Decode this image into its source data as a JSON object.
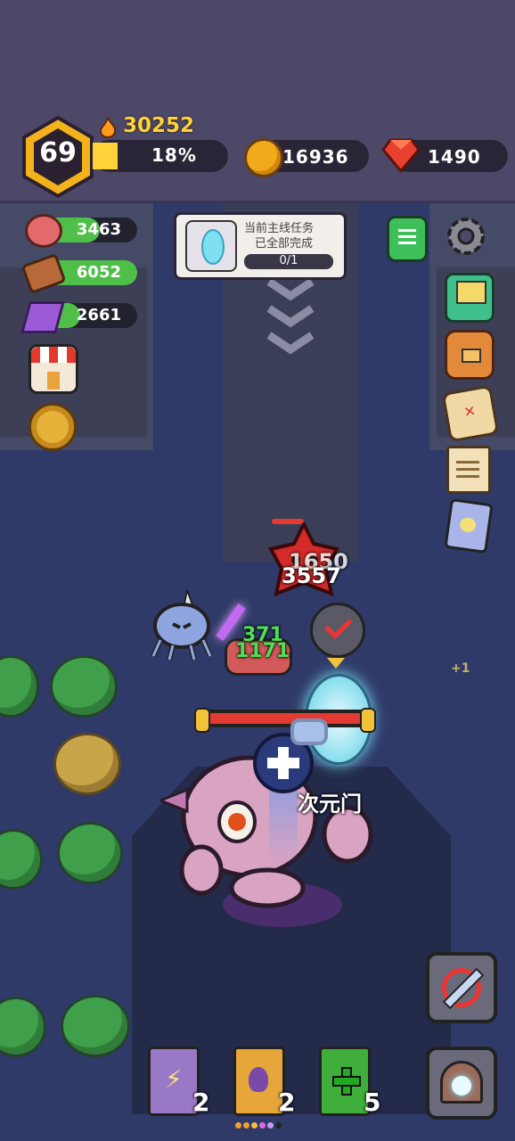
{
  "player": {
    "level": "69",
    "power": "30252",
    "progress_label": "18%",
    "progress": 0.18
  },
  "currency": {
    "gold": "16936",
    "gems": "1490"
  },
  "resources": [
    {
      "icon": "meat-icon",
      "value": "3463"
    },
    {
      "icon": "wood-icon",
      "value": "6052"
    },
    {
      "icon": "ore-icon",
      "value": "2661"
    }
  ],
  "quest": {
    "line1": "当前主线任务",
    "line2": "已全部完成",
    "progress": "0/1"
  },
  "combat": {
    "damage_numbers": [
      "1650",
      "3557",
      "371",
      "1171"
    ],
    "pickup": "+1",
    "boss_name": "次元门"
  },
  "skill_books": [
    {
      "icon": "lightning-book-icon",
      "count": "2"
    },
    {
      "icon": "fire-book-icon",
      "count": "2"
    },
    {
      "icon": "heal-book-icon",
      "count": "5"
    }
  ],
  "colors": {
    "gold": "#ffd23a",
    "gem": "#e8412d",
    "health": "#e33a33",
    "resource_bar": "#4fbf4a"
  }
}
